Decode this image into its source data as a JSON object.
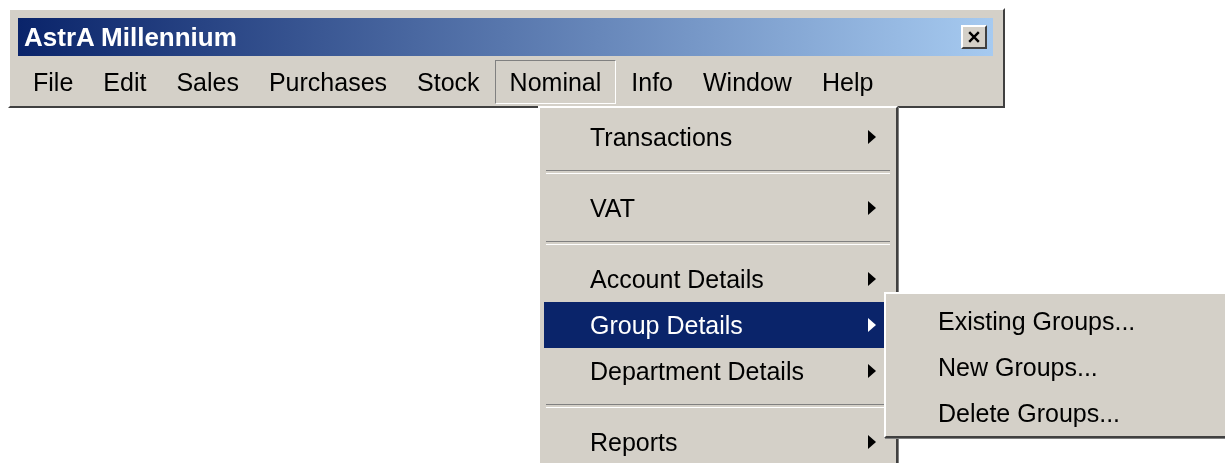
{
  "window": {
    "title": "AstrA Millennium"
  },
  "menu_bar": [
    {
      "label": "File",
      "selected": false
    },
    {
      "label": "Edit",
      "selected": false
    },
    {
      "label": "Sales",
      "selected": false
    },
    {
      "label": "Purchases",
      "selected": false
    },
    {
      "label": "Stock",
      "selected": false
    },
    {
      "label": "Nominal",
      "selected": true
    },
    {
      "label": "Info",
      "selected": false
    },
    {
      "label": "Window",
      "selected": false
    },
    {
      "label": "Help",
      "selected": false
    }
  ],
  "dropdown": {
    "items": [
      {
        "kind": "item",
        "label": "Transactions",
        "submenu": true,
        "selected": false
      },
      {
        "kind": "separator"
      },
      {
        "kind": "item",
        "label": "VAT",
        "submenu": true,
        "selected": false
      },
      {
        "kind": "separator"
      },
      {
        "kind": "item",
        "label": "Account Details",
        "submenu": true,
        "selected": false
      },
      {
        "kind": "item",
        "label": "Group Details",
        "submenu": true,
        "selected": true
      },
      {
        "kind": "item",
        "label": "Department Details",
        "submenu": true,
        "selected": false
      },
      {
        "kind": "separator"
      },
      {
        "kind": "item",
        "label": "Reports",
        "submenu": true,
        "selected": false
      }
    ]
  },
  "submenu": {
    "items": [
      {
        "kind": "item",
        "label": "Existing Groups...",
        "selected": false
      },
      {
        "kind": "item",
        "label": "New Groups...",
        "selected": false
      },
      {
        "kind": "item",
        "label": "Delete Groups...",
        "selected": false
      }
    ]
  }
}
